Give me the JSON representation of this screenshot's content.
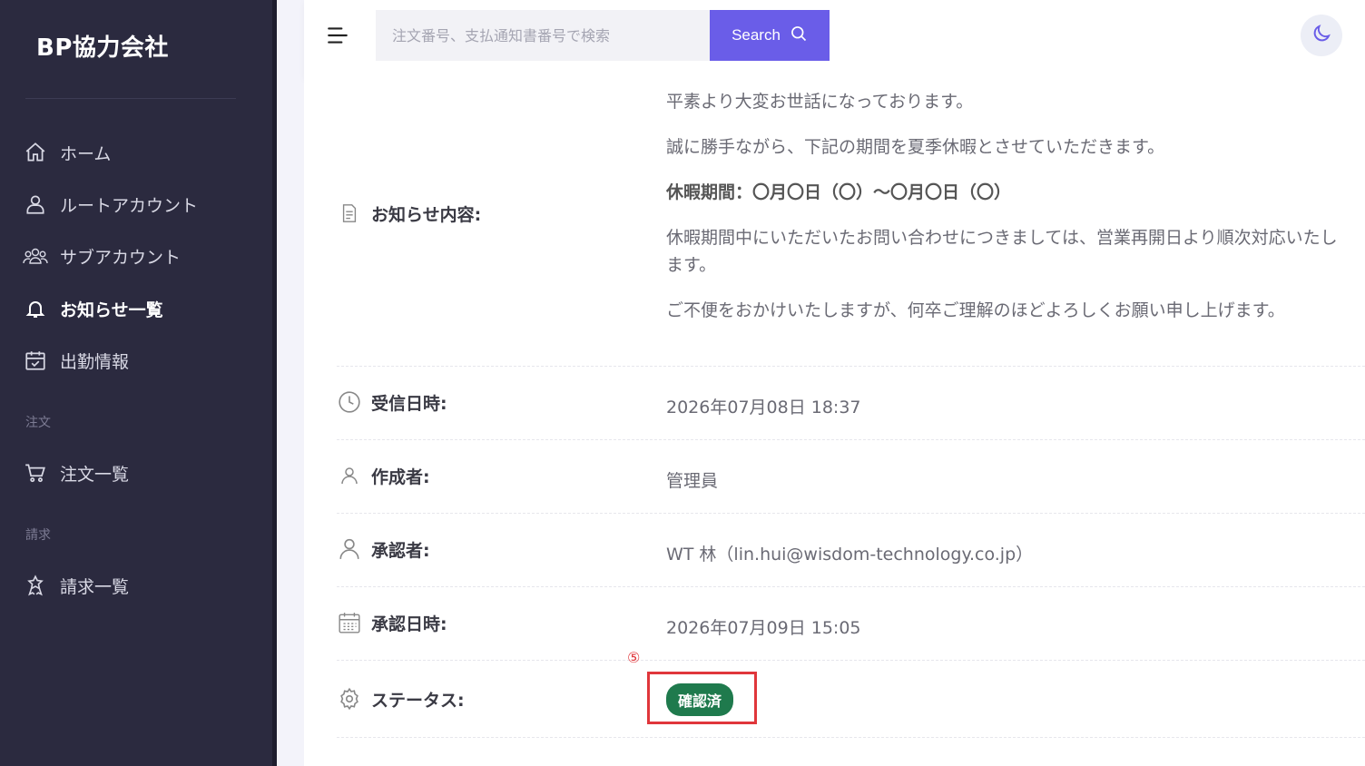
{
  "brand": "BP協力会社",
  "sidebar": {
    "items": [
      {
        "label": "ホーム",
        "icon": "home-icon"
      },
      {
        "label": "ルートアカウント",
        "icon": "user-icon"
      },
      {
        "label": "サブアカウント",
        "icon": "users-icon"
      },
      {
        "label": "お知らせ一覧",
        "icon": "bell-icon",
        "active": true
      },
      {
        "label": "出勤情報",
        "icon": "calendar-check-icon"
      }
    ],
    "section_order": "注文",
    "order_items": [
      {
        "label": "注文一覧",
        "icon": "cart-icon"
      }
    ],
    "section_billing": "請求",
    "billing_items": [
      {
        "label": "請求一覧",
        "icon": "badge-icon"
      }
    ]
  },
  "header": {
    "search_placeholder": "注文番号、支払通知書番号で検索",
    "search_label": "Search"
  },
  "notice": {
    "content_label": "お知らせ内容:",
    "lines": [
      "平素より大変お世話になっております。",
      "誠に勝手ながら、下記の期間を夏季休暇とさせていただきます。",
      "休暇期間：〇月〇日（〇）～〇月〇日（〇）",
      "休暇期間中にいただいたお問い合わせにつきましては、営業再開日より順次対応いたします。",
      "ご不便をおかけいたしますが、何卒ご理解のほどよろしくお願い申し上げます。"
    ],
    "received_label": "受信日時:",
    "received_value": "2026年07月08日 18:37",
    "author_label": "作成者:",
    "author_value": "管理員",
    "approver_label": "承認者:",
    "approver_value": "WT 林（lin.hui@wisdom-technology.co.jp）",
    "approved_at_label": "承認日時:",
    "approved_at_value": "2026年07月09日 15:05",
    "status_label": "ステータス:",
    "status_value": "確認済"
  },
  "annotation_marker": "⑤",
  "colors": {
    "sidebar_bg": "#2b2a3f",
    "accent": "#6a5de8",
    "status_green": "#1f7a4d",
    "highlight_red": "#e0363b"
  }
}
